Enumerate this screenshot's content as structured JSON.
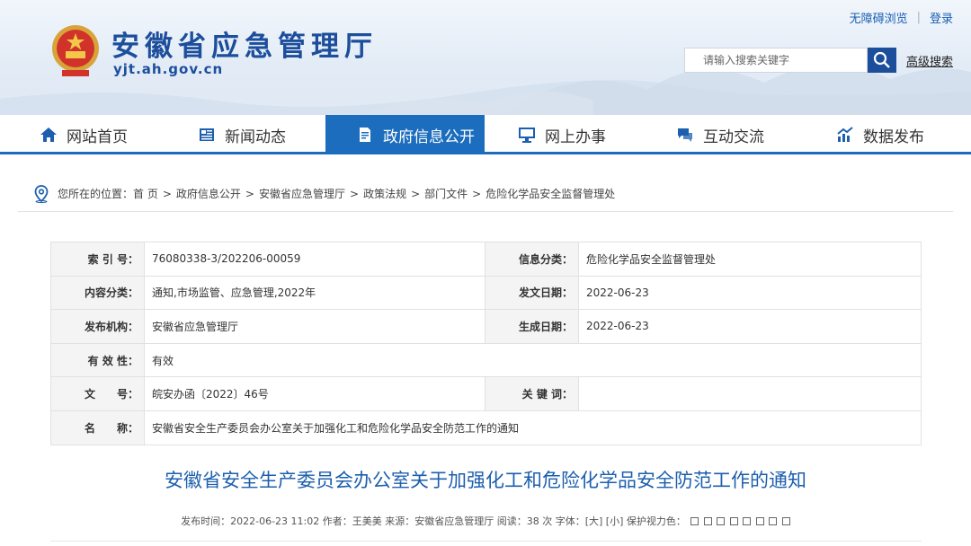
{
  "topbar": {
    "accessibility": "无障碍浏览",
    "login": "登录"
  },
  "header": {
    "title": "安徽省应急管理厅",
    "domain": "yjt.ah.gov.cn"
  },
  "search": {
    "placeholder": "请输入搜索关键字",
    "advanced": "高级搜索"
  },
  "nav": [
    {
      "label": "网站首页",
      "icon": "home-icon"
    },
    {
      "label": "新闻动态",
      "icon": "news-icon"
    },
    {
      "label": "政府信息公开",
      "icon": "document-icon",
      "active": true
    },
    {
      "label": "网上办事",
      "icon": "monitor-icon"
    },
    {
      "label": "互动交流",
      "icon": "chat-icon"
    },
    {
      "label": "数据发布",
      "icon": "chart-icon"
    }
  ],
  "breadcrumb": {
    "prefix": "您所在的位置：",
    "items": [
      "首 页",
      "政府信息公开",
      "安徽省应急管理厅",
      "政策法规",
      "部门文件",
      "危险化学品安全监督管理处"
    ],
    "sep": ">"
  },
  "meta": {
    "index_label": "索 引 号：",
    "index_value": "76080338-3/202206-00059",
    "category_label": "信息分类：",
    "category_value": "危险化学品安全监督管理处",
    "content_label": "内容分类：",
    "content_value": "通知,市场监管、应急管理,2022年",
    "issue_date_label": "发文日期：",
    "issue_date_value": "2022-06-23",
    "publisher_label": "发布机构：",
    "publisher_value": "安徽省应急管理厅",
    "gen_date_label": "生成日期：",
    "gen_date_value": "2022-06-23",
    "validity_label": "有 效 性：",
    "validity_value": "有效",
    "docno_label": "文　　号：",
    "docno_value": "皖安办函〔2022〕46号",
    "keywords_label": "关 键 词：",
    "keywords_value": "",
    "name_label": "名　　称：",
    "name_value": "安徽省安全生产委员会办公室关于加强化工和危险化学品安全防范工作的通知"
  },
  "article": {
    "title": "安徽省安全生产委员会办公室关于加强化工和危险化学品安全防范工作的通知",
    "info": "发布时间：2022-06-23 11:02   作者：王美美   来源：安徽省应急管理厅   阅读：38 次   字体：[大] [小]   保护视力色："
  },
  "colors": {
    "brand": "#1c4e9c",
    "nav_active": "#1c6dbd",
    "title_blue": "#1c5fae"
  }
}
